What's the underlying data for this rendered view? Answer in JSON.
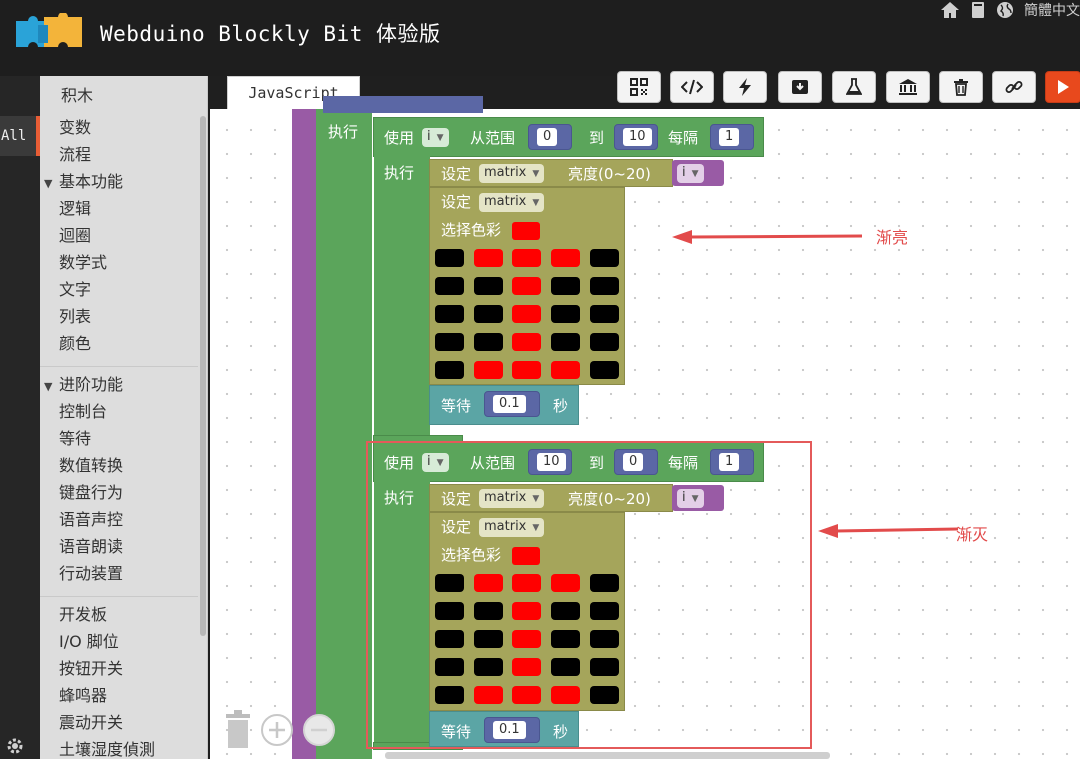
{
  "header": {
    "app_title": "Webduino Blockly Bit 体验版",
    "language": "簡體中文",
    "icons": [
      "home-icon",
      "book-icon",
      "globe-icon"
    ]
  },
  "rail": {
    "all_tab": "All"
  },
  "toolbox": {
    "heading": "积木",
    "items": [
      {
        "label": "变数",
        "type": "item"
      },
      {
        "label": "流程",
        "type": "item"
      },
      {
        "label": "基本功能",
        "type": "group"
      },
      {
        "label": "逻辑",
        "type": "item"
      },
      {
        "label": "迴圈",
        "type": "item"
      },
      {
        "label": "数学式",
        "type": "item"
      },
      {
        "label": "文字",
        "type": "item"
      },
      {
        "label": "列表",
        "type": "item"
      },
      {
        "label": "颜色",
        "type": "item"
      },
      {
        "label": "",
        "type": "sep"
      },
      {
        "label": "进阶功能",
        "type": "group"
      },
      {
        "label": "控制台",
        "type": "item"
      },
      {
        "label": "等待",
        "type": "item"
      },
      {
        "label": "数值转换",
        "type": "item"
      },
      {
        "label": "键盘行为",
        "type": "item"
      },
      {
        "label": "语音声控",
        "type": "item"
      },
      {
        "label": "语音朗读",
        "type": "item"
      },
      {
        "label": "行动装置",
        "type": "item"
      },
      {
        "label": "",
        "type": "sep"
      },
      {
        "label": "开发板",
        "type": "item"
      },
      {
        "label": "I/O 脚位",
        "type": "item"
      },
      {
        "label": "按钮开关",
        "type": "item"
      },
      {
        "label": "蜂鸣器",
        "type": "item"
      },
      {
        "label": "震动开关",
        "type": "item"
      },
      {
        "label": "土壤湿度偵測",
        "type": "item"
      }
    ]
  },
  "toolbar": {
    "tab_label": "JavaScript",
    "buttons": [
      "qr-code-icon",
      "code-icon",
      "bolt-icon",
      "download-icon",
      "flask-icon",
      "library-icon",
      "trash-icon",
      "link-icon",
      "play-icon"
    ]
  },
  "workspace": {
    "outer_do": "执行",
    "colors": {
      "loop": "#5ba55b",
      "matrix": "#a5a55b",
      "wait": "#5ba5a5",
      "number": "#5b67a5",
      "variable": "#995ba5",
      "on": "#ff0000",
      "off": "#000000"
    },
    "loops": [
      {
        "use": "使用",
        "var": "i",
        "from": "从范围",
        "start": "0",
        "to": "到",
        "end": "10",
        "step_label": "每隔",
        "step": "1",
        "do": "执行",
        "set1": "设定",
        "matrix1": "matrix",
        "brightness": "亮度(0~20)",
        "bvar": "i",
        "set2": "设定",
        "matrix2": "matrix",
        "pick_color": "选择色彩",
        "grid": [
          [
            0,
            1,
            1,
            1,
            0
          ],
          [
            0,
            0,
            1,
            0,
            0
          ],
          [
            0,
            0,
            1,
            0,
            0
          ],
          [
            0,
            0,
            1,
            0,
            0
          ],
          [
            0,
            1,
            1,
            1,
            0
          ]
        ],
        "wait": "等待",
        "wait_val": "0.1",
        "sec": "秒"
      },
      {
        "use": "使用",
        "var": "i",
        "from": "从范围",
        "start": "10",
        "to": "到",
        "end": "0",
        "step_label": "每隔",
        "step": "1",
        "do": "执行",
        "set1": "设定",
        "matrix1": "matrix",
        "brightness": "亮度(0~20)",
        "bvar": "i",
        "set2": "设定",
        "matrix2": "matrix",
        "pick_color": "选择色彩",
        "grid": [
          [
            0,
            1,
            1,
            1,
            0
          ],
          [
            0,
            0,
            1,
            0,
            0
          ],
          [
            0,
            0,
            1,
            0,
            0
          ],
          [
            0,
            0,
            1,
            0,
            0
          ],
          [
            0,
            1,
            1,
            1,
            0
          ]
        ],
        "wait": "等待",
        "wait_val": "0.1",
        "sec": "秒"
      }
    ]
  },
  "annotations": {
    "fade_in": "渐亮",
    "fade_out": "渐灭",
    "color": "#e24b4b"
  }
}
